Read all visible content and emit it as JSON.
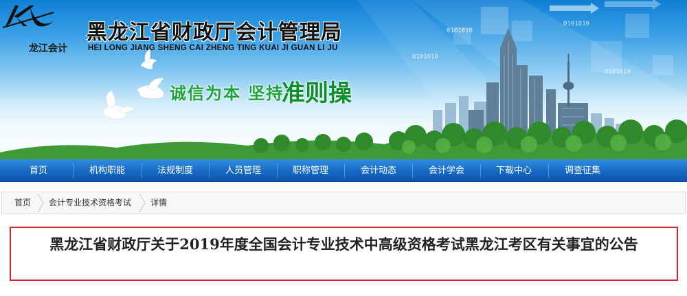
{
  "header": {
    "logo_text": "龙江会计",
    "site_title": "黑龙江省财政厅会计管理局",
    "site_pinyin": "HEI LONG JIANG SHENG CAI ZHENG TING KUAI JI GUAN LI JU",
    "slogan": "诚信为本 坚持",
    "slogan_big": "准则操",
    "binary_text": "0101010"
  },
  "nav": {
    "items": [
      {
        "label": "首页"
      },
      {
        "label": "机构职能"
      },
      {
        "label": "法规制度"
      },
      {
        "label": "人员管理"
      },
      {
        "label": "职称管理"
      },
      {
        "label": "会计动态"
      },
      {
        "label": "会计学会"
      },
      {
        "label": "下载中心"
      },
      {
        "label": "调查征集"
      }
    ]
  },
  "breadcrumb": {
    "items": [
      {
        "label": "首页"
      },
      {
        "label": "会计专业技术资格考试"
      },
      {
        "label": "详情"
      }
    ]
  },
  "article": {
    "title": "黑龙江省财政厅关于2019年度全国会计专业技术中高级资格考试黑龙江考区有关事宜的公告"
  },
  "colors": {
    "nav_bg": "#1668c4",
    "highlight_border": "#d8232a",
    "slogan_green": "#1da33a"
  }
}
